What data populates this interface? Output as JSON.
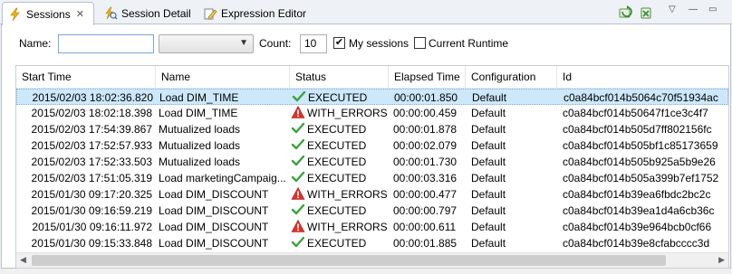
{
  "tabs": [
    {
      "label": "Sessions",
      "icon": "bolt-icon",
      "active": true,
      "closable": true
    },
    {
      "label": "Session Detail",
      "icon": "bolt-search-icon",
      "active": false
    },
    {
      "label": "Expression Editor",
      "icon": "pencil-icon",
      "active": false
    }
  ],
  "toolbar": {
    "refresh_icon": "refresh-icon",
    "purge_icon": "purge-icon",
    "view_menu": "▽",
    "minimize": "—",
    "maximize": "▭"
  },
  "filters": {
    "name_label": "Name:",
    "name_value": "",
    "configuration_value": "",
    "count_label": "Count:",
    "count_value": "10",
    "my_sessions_label": "My sessions",
    "my_sessions_checked": true,
    "current_runtime_label": "Current Runtime",
    "current_runtime_checked": false
  },
  "table": {
    "columns": [
      "Start Time",
      "Name",
      "Status",
      "Elapsed Time",
      "Configuration",
      "Id"
    ],
    "rows": [
      {
        "start": "2015/02/03 18:02:36.820",
        "name": "Load DIM_TIME",
        "status": "EXECUTED",
        "status_type": "ok",
        "elapsed": "00:00:01.850",
        "config": "Default",
        "id": "c0a84bcf014b5064c70f51934ac",
        "selected": true
      },
      {
        "start": "2015/02/03 18:02:18.398",
        "name": "Load DIM_TIME",
        "status": "WITH_ERRORS",
        "status_type": "error",
        "elapsed": "00:00:00.459",
        "config": "Default",
        "id": "c0a84bcf014b50647f1ce3c4f7",
        "selected": false
      },
      {
        "start": "2015/02/03 17:54:39.867",
        "name": "Mutualized loads",
        "status": "EXECUTED",
        "status_type": "ok",
        "elapsed": "00:00:01.878",
        "config": "Default",
        "id": "c0a84bcf014b505d7ff802156fc",
        "selected": false
      },
      {
        "start": "2015/02/03 17:52:57.933",
        "name": "Mutualized loads",
        "status": "EXECUTED",
        "status_type": "ok",
        "elapsed": "00:00:02.079",
        "config": "Default",
        "id": "c0a84bcf014b505bf1c85173659",
        "selected": false
      },
      {
        "start": "2015/02/03 17:52:33.503",
        "name": "Mutualized loads",
        "status": "EXECUTED",
        "status_type": "ok",
        "elapsed": "00:00:01.730",
        "config": "Default",
        "id": "c0a84bcf014b505b925a5b9e26",
        "selected": false
      },
      {
        "start": "2015/02/03 17:51:05.319",
        "name": "Load marketingCampaig...",
        "status": "EXECUTED",
        "status_type": "ok",
        "elapsed": "00:00:03.316",
        "config": "Default",
        "id": "c0a84bcf014b505a399b7ef1752",
        "selected": false
      },
      {
        "start": "2015/01/30 09:17:20.325",
        "name": "Load DIM_DISCOUNT",
        "status": "WITH_ERRORS",
        "status_type": "error",
        "elapsed": "00:00:00.477",
        "config": "Default",
        "id": "c0a84bcf014b39ea6fbdc2bc2c",
        "selected": false
      },
      {
        "start": "2015/01/30 09:16:59.219",
        "name": "Load DIM_DISCOUNT",
        "status": "EXECUTED",
        "status_type": "ok",
        "elapsed": "00:00:00.797",
        "config": "Default",
        "id": "c0a84bcf014b39ea1d4a6cb36c",
        "selected": false
      },
      {
        "start": "2015/01/30 09:16:11.972",
        "name": "Load DIM_DISCOUNT",
        "status": "WITH_ERRORS",
        "status_type": "error",
        "elapsed": "00:00:00.611",
        "config": "Default",
        "id": "c0a84bcf014b39e964bcb0cf66",
        "selected": false
      },
      {
        "start": "2015/01/30 09:15:33.848",
        "name": "Load DIM_DISCOUNT",
        "status": "EXECUTED",
        "status_type": "ok",
        "elapsed": "00:00:01.885",
        "config": "Default",
        "id": "c0a84bcf014b39e8cfabcccc3d",
        "selected": false
      }
    ]
  },
  "colors": {
    "selection": "#cde8fb",
    "ok_check": "#3aa33a",
    "error_triangle": "#d9342b"
  }
}
